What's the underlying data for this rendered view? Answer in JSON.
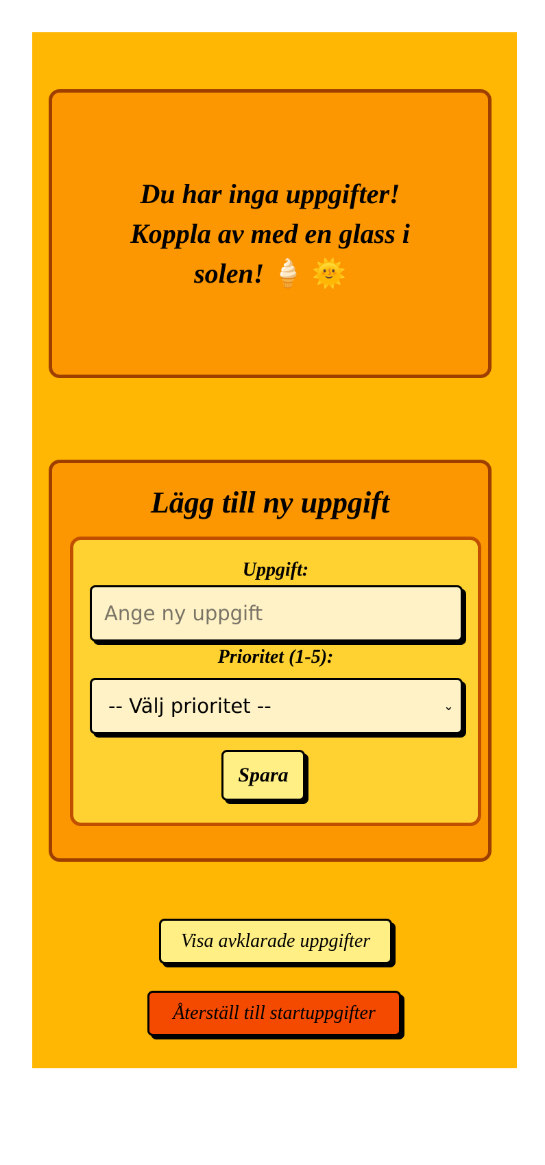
{
  "empty_state": {
    "message": "Du har inga uppgifter! Koppla av med en glass i solen!",
    "icons": [
      "ice-cream-icon",
      "sun-icon"
    ],
    "emoji": "🍦 🌞"
  },
  "form": {
    "title": "Lägg till ny uppgift",
    "task_label": "Uppgift:",
    "task_placeholder": "Ange ny uppgift",
    "task_value": "",
    "priority_label": "Prioritet (1-5):",
    "priority_selected": "-- Välj prioritet --",
    "save_label": "Spara"
  },
  "actions": {
    "show_completed_label": "Visa avklarade uppgifter",
    "reset_label": "Återställ till startuppgifter"
  },
  "colors": {
    "background": "#FFB703",
    "card": "#FC9601",
    "card_border": "#9E3F00",
    "inner": "#FFD232",
    "input": "#FEF2C6",
    "button": "#FFEF85",
    "reset": "#F44A00"
  }
}
